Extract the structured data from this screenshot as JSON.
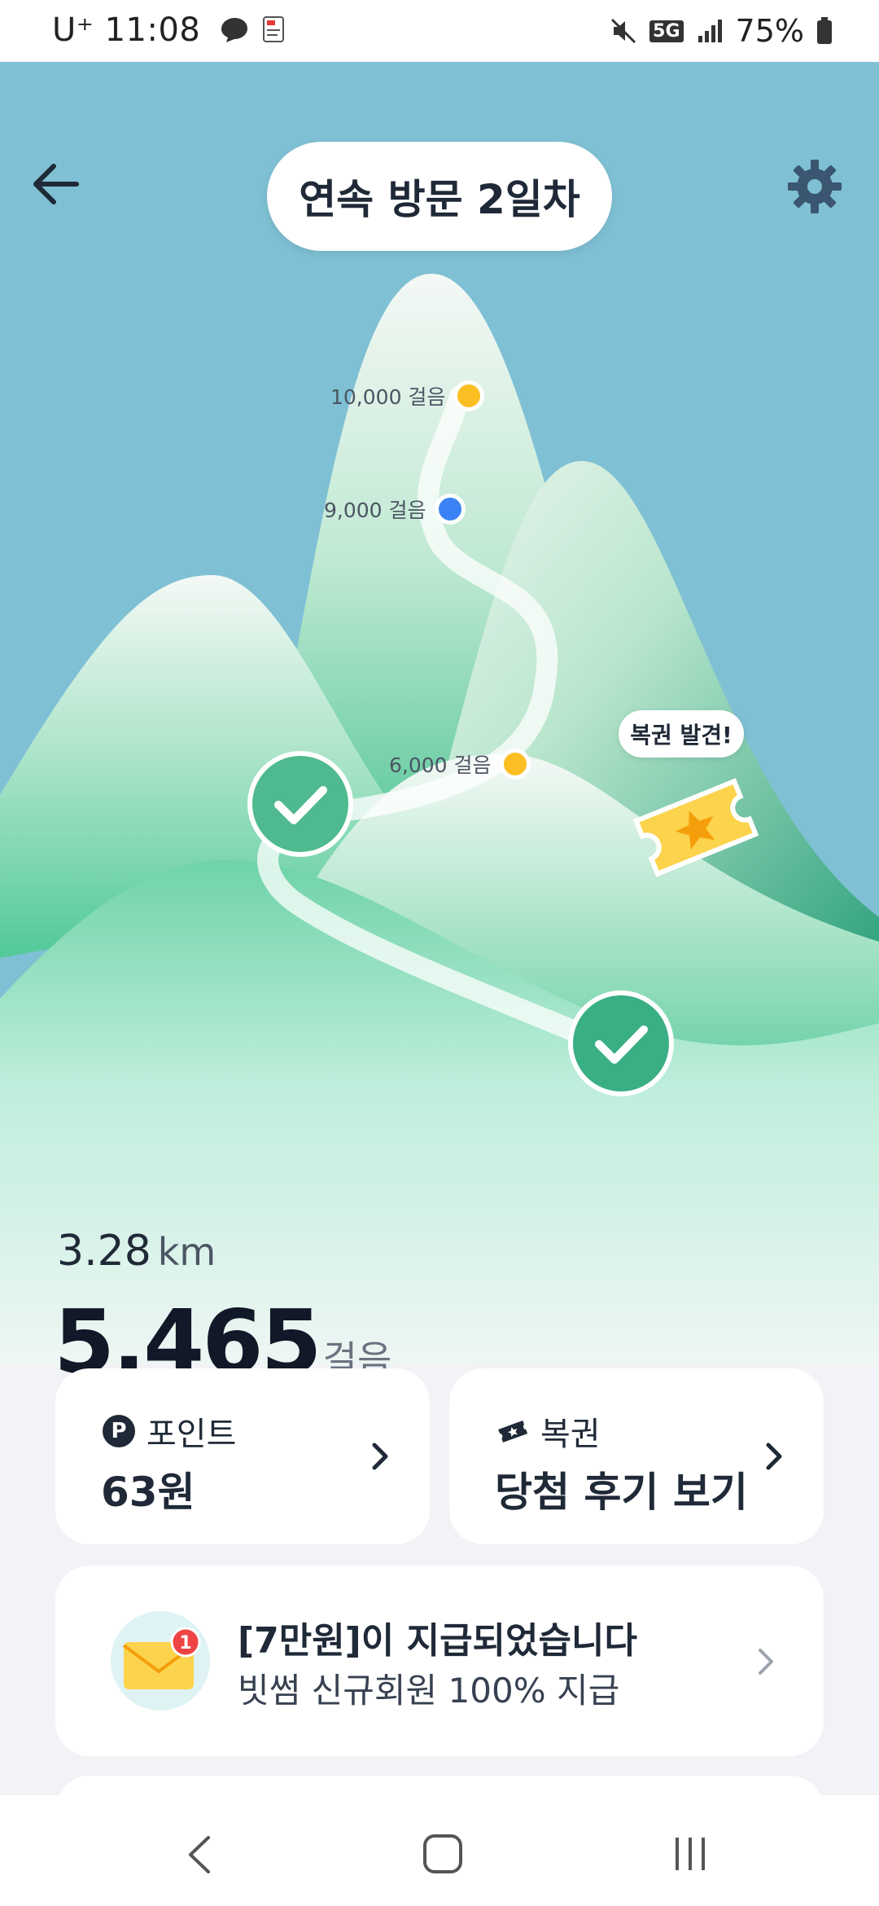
{
  "status_bar": {
    "carrier": "U⁺",
    "time": "11:08",
    "battery": "75%",
    "network": "5G"
  },
  "header": {
    "visit_badge": "연속 방문 2일차"
  },
  "map": {
    "milestones": [
      {
        "label": "10,000 걸음",
        "color": "#fbbf24"
      },
      {
        "label": "9,000 걸음",
        "color": "#3b82f6"
      },
      {
        "label": "6,000 걸음",
        "color": "#fbbf24"
      }
    ],
    "lottery_bubble": "복권 발견!"
  },
  "stats": {
    "distance_value": "3.28",
    "distance_unit": "km",
    "steps_value": "5,465",
    "steps_unit": "걸음"
  },
  "cards": {
    "points": {
      "label": "포인트",
      "value": "63원",
      "badge": "P"
    },
    "lottery": {
      "label": "복권",
      "value": "당첨 후기 보기"
    }
  },
  "notice": {
    "title": "[7만원]이 지급되었습니다",
    "subtitle": "빗썸 신규회원 100% 지급",
    "badge_count": "1"
  },
  "colors": {
    "sky": "#7fc0d4",
    "mountain_green": "#4cc89a",
    "dot_yellow": "#fbbf24",
    "dot_blue": "#3b82f6"
  }
}
